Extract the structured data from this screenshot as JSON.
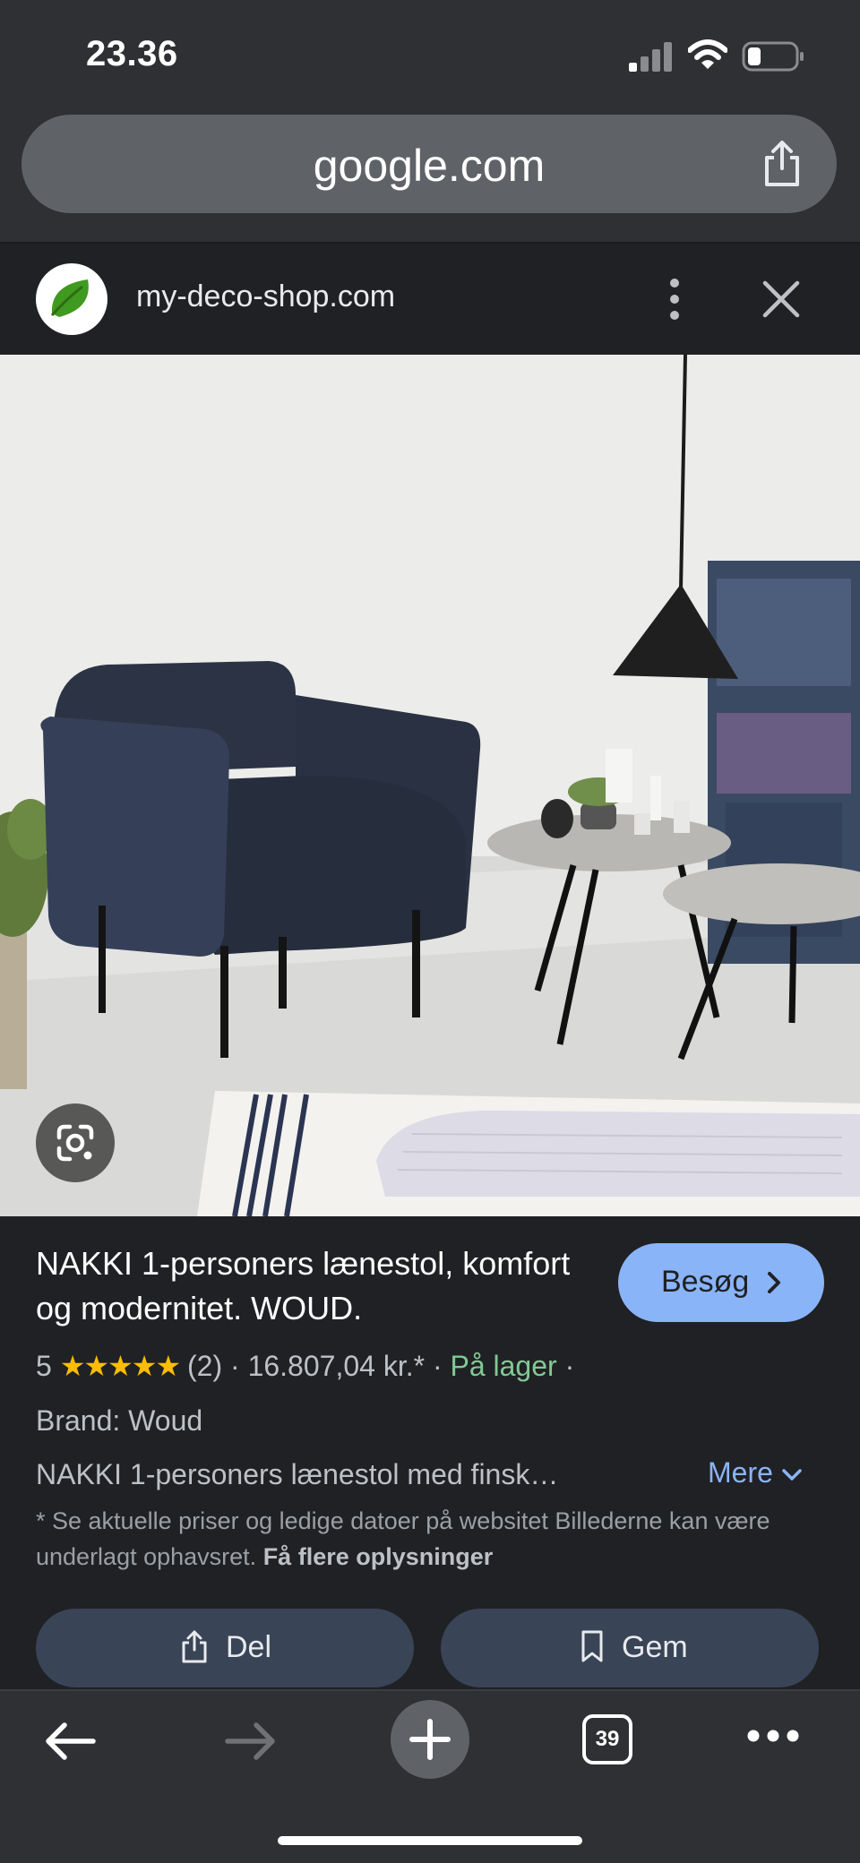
{
  "status": {
    "time": "23.36"
  },
  "browser": {
    "url": "google.com",
    "tab_count": "39"
  },
  "site": {
    "name": "my-deco-shop.com"
  },
  "product": {
    "title": "NAKKI 1-personers lænestol, komfort og modernitet. WOUD.",
    "visit_label": "Besøg",
    "rating_value": "5",
    "stars": "★★★★★",
    "review_count": "(2)",
    "separator": "·",
    "price": "16.807,04 kr.*",
    "stock": "På lager",
    "brand": "Brand: Woud",
    "description": "NAKKI 1-personers lænestol med finsk…",
    "more_label": "Mere",
    "disclaimer": "* Se aktuelle priser og ledige datoer på websitet Billederne kan være underlagt ophavsret.",
    "disclaimer_link": "Få flere oplysninger",
    "share_label": "Del",
    "save_label": "Gem"
  },
  "colors": {
    "accent_blue": "#8ab4f8",
    "in_stock_green": "#81c995",
    "star_yellow": "#fbbc04",
    "button_bg": "#394457"
  },
  "icons": [
    "cellular-signal-icon",
    "wifi-icon",
    "battery-icon",
    "share-icon",
    "leaf-favicon",
    "kebab-menu-icon",
    "close-icon",
    "google-lens-icon",
    "chevron-right-icon",
    "chevron-down-icon",
    "bookmark-icon",
    "back-arrow-icon",
    "forward-arrow-icon",
    "new-tab-plus-icon",
    "tabs-icon",
    "more-dots-icon"
  ]
}
